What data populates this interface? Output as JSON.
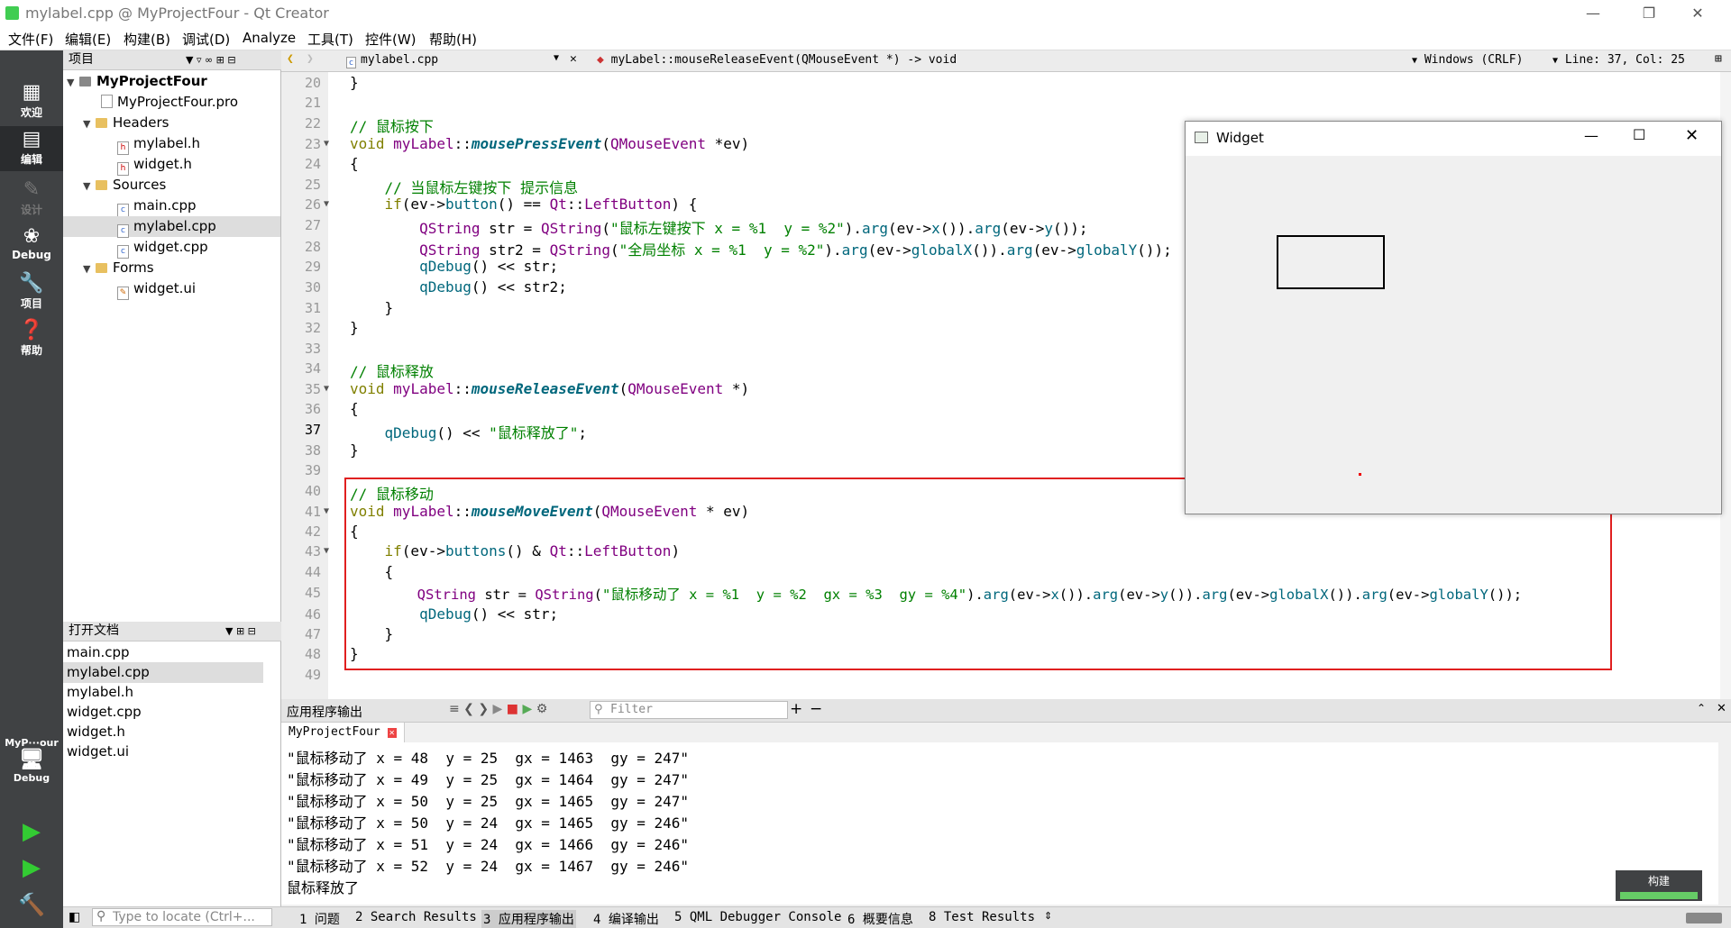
{
  "window": {
    "title": "mylabel.cpp @ MyProjectFour - Qt Creator"
  },
  "menu": [
    "文件(F)",
    "编辑(E)",
    "构建(B)",
    "调试(D)",
    "Analyze",
    "工具(T)",
    "控件(W)",
    "帮助(H)"
  ],
  "modes": [
    "欢迎",
    "编辑",
    "设计",
    "Debug",
    "项目",
    "帮助"
  ],
  "kit": {
    "project": "MyP···our",
    "config": "Debug"
  },
  "project_panel": {
    "title": "项目",
    "root": "MyProjectFour",
    "pro": "MyProjectFour.pro",
    "headers": "Headers",
    "h_files": [
      "mylabel.h",
      "widget.h"
    ],
    "sources": "Sources",
    "s_files": [
      "main.cpp",
      "mylabel.cpp",
      "widget.cpp"
    ],
    "forms": "Forms",
    "ui_files": [
      "widget.ui"
    ]
  },
  "open_docs": {
    "title": "打开文档",
    "items": [
      "main.cpp",
      "mylabel.cpp",
      "mylabel.h",
      "widget.cpp",
      "widget.h",
      "widget.ui"
    ]
  },
  "editor_bar": {
    "file": "mylabel.cpp",
    "symbol": "myLabel::mouseReleaseEvent(QMouseEvent *) -> void",
    "encoding": "Windows (CRLF)",
    "position": "Line: 37, Col: 25"
  },
  "line_numbers": [
    "20",
    "21",
    "22",
    "23",
    "24",
    "25",
    "26",
    "27",
    "28",
    "29",
    "30",
    "31",
    "32",
    "33",
    "34",
    "35",
    "36",
    "37",
    "38",
    "39",
    "40",
    "41",
    "42",
    "43",
    "44",
    "45",
    "46",
    "47",
    "48",
    "49"
  ],
  "widget": {
    "title": "Widget"
  },
  "output": {
    "title": "应用程序输出",
    "filter_placeholder": "Filter",
    "tab": "MyProjectFour",
    "lines": [
      "\"鼠标移动了 x = 48  y = 25  gx = 1463  gy = 247\"",
      "\"鼠标移动了 x = 49  y = 25  gx = 1464  gy = 247\"",
      "\"鼠标移动了 x = 50  y = 25  gx = 1465  gy = 247\"",
      "\"鼠标移动了 x = 50  y = 24  gx = 1465  gy = 246\"",
      "\"鼠标移动了 x = 51  y = 24  gx = 1466  gy = 246\"",
      "\"鼠标移动了 x = 52  y = 24  gx = 1467  gy = 246\"",
      "鼠标释放了"
    ]
  },
  "build": {
    "label": "构建"
  },
  "statusbar": {
    "locate_placeholder": "Type to locate (Ctrl+...",
    "tabs": [
      "1 问题",
      "2 Search Results",
      "3 应用程序输出",
      "4 编译输出",
      "5 QML Debugger Console",
      "6 概要信息",
      "8 Test Results"
    ]
  }
}
